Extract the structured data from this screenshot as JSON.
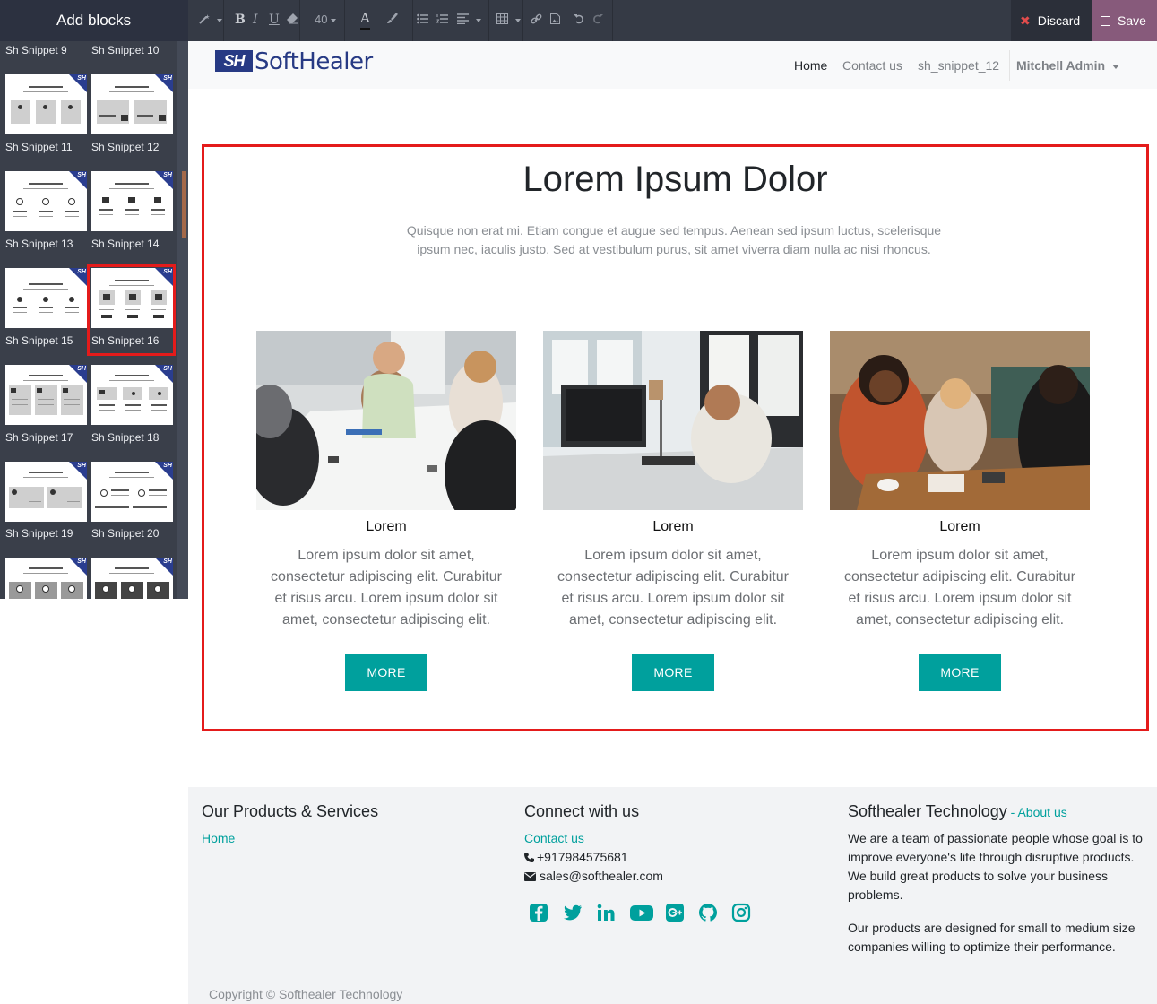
{
  "editor": {
    "panel_title": "Add blocks",
    "snippet_labels": [
      "Sh Snippet 9",
      "Sh Snippet 10",
      "Sh Snippet 11",
      "Sh Snippet 12",
      "Sh Snippet 13",
      "Sh Snippet 14",
      "Sh Snippet 15",
      "Sh Snippet 16",
      "Sh Snippet 17",
      "Sh Snippet 18",
      "Sh Snippet 19",
      "Sh Snippet 20"
    ],
    "selected_snippet": "Sh Snippet 16",
    "thumb_badge": "SH",
    "toolbar": {
      "font_size": "40",
      "bold": "B",
      "italic": "I",
      "underline": "U",
      "font_color": "A",
      "discard_label": "Discard",
      "save_label": "Save"
    },
    "colors": {
      "selection_outline": "#e41b1b",
      "save_bg": "#875a7b",
      "accent": "#00a09d",
      "brand": "#273a84"
    }
  },
  "site": {
    "logo": {
      "mark": "SH",
      "text": "SoftHealer"
    },
    "nav": [
      "Home",
      "Contact us",
      "sh_snippet_12"
    ],
    "active_nav": "Home",
    "user": "Mitchell Admin"
  },
  "section": {
    "title": "Lorem Ipsum Dolor",
    "subtitle": "Quisque non erat mi. Etiam congue et augue sed tempus. Aenean sed ipsum luctus, scelerisque ipsum nec, iaculis justo. Sed at vestibulum purus, sit amet viverra diam nulla ac nisi rhoncus.",
    "cards": [
      {
        "title": "Lorem",
        "text": "Lorem ipsum dolor sit amet, consectetur adipiscing elit. Curabitur et risus arcu. Lorem ipsum dolor sit amet, consectetur adipiscing elit.",
        "button": "MORE"
      },
      {
        "title": "Lorem",
        "text": "Lorem ipsum dolor sit amet, consectetur adipiscing elit. Curabitur et risus arcu. Lorem ipsum dolor sit amet, consectetur adipiscing elit.",
        "button": "MORE"
      },
      {
        "title": "Lorem",
        "text": "Lorem ipsum dolor sit amet, consectetur adipiscing elit. Curabitur et risus arcu. Lorem ipsum dolor sit amet, consectetur adipiscing elit.",
        "button": "MORE"
      }
    ]
  },
  "footer": {
    "products": {
      "heading": "Our Products & Services",
      "links": [
        "Home"
      ]
    },
    "connect": {
      "heading": "Connect with us",
      "contact_link": "Contact us",
      "phone": "+917984575681",
      "email": "sales@softhealer.com",
      "social_icons": [
        "facebook-icon",
        "twitter-icon",
        "linkedin-icon",
        "youtube-icon",
        "google-plus-icon",
        "github-icon",
        "instagram-icon"
      ]
    },
    "about": {
      "heading": "Softhealer Technology",
      "dash": " - ",
      "about_link": "About us",
      "paragraph1": "We are a team of passionate people whose goal is to improve everyone's life through disruptive products. We build great products to solve your business problems.",
      "paragraph2": "Our products are designed for small to medium size companies willing to optimize their performance."
    },
    "copyright": "Copyright © Softhealer Technology"
  }
}
